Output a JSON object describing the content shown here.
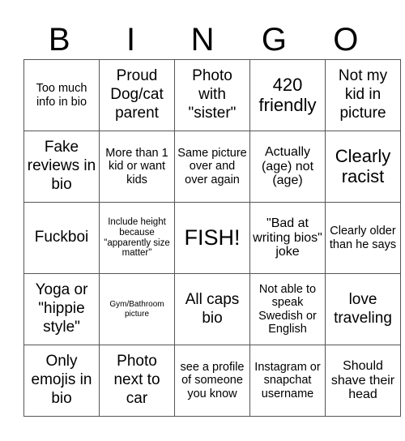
{
  "header": {
    "letters": [
      "B",
      "I",
      "N",
      "G",
      "O"
    ]
  },
  "rows": [
    [
      "Too much info in bio",
      "Proud Dog/cat parent",
      "Photo with \"sister\"",
      "420 friendly",
      "Not my kid in picture"
    ],
    [
      "Fake reviews in bio",
      "More than 1 kid or want kids",
      "Same picture over and over again",
      "Actually (age) not (age)",
      "Clearly racist"
    ],
    [
      "Fuckboi",
      "Include height because \"apparently size matter\"",
      "FISH!",
      "\"Bad at writing bios\" joke",
      "Clearly older than he says"
    ],
    [
      "Yoga or \"hippie style\"",
      "Gym/Bathroom picture",
      "All caps bio",
      "Not able to speak Swedish or English",
      "love traveling"
    ],
    [
      "Only emojis in bio",
      "Photo next to car",
      "see a profile of someone you know",
      "Instagram or snapchat username",
      "Should shave their head"
    ]
  ]
}
